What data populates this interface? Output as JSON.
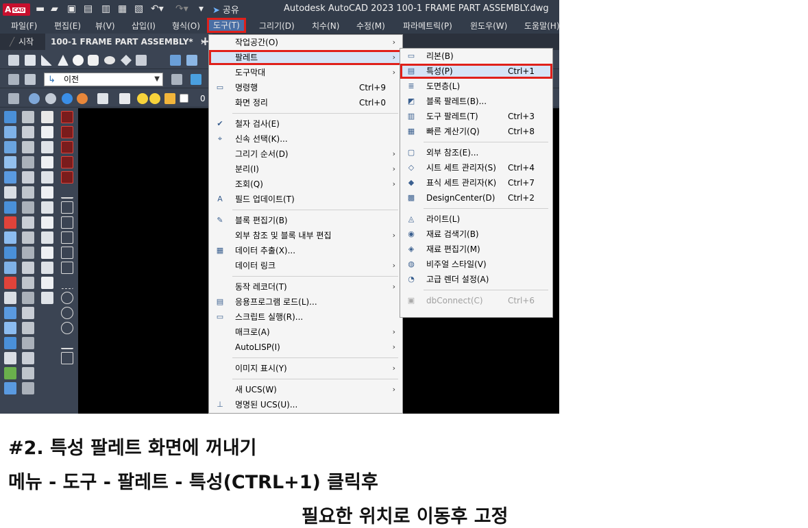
{
  "titlebar": {
    "logo_text": "A",
    "logo_badge": "CAD",
    "share_label": "공유",
    "window_title": "Autodesk AutoCAD 2023    100-1 FRAME PART ASSEMBLY.dwg"
  },
  "menubar": {
    "items": [
      "파일(F)",
      "편집(E)",
      "뷰(V)",
      "삽입(I)",
      "형식(O)",
      "도구(T)",
      "그리기(D)",
      "치수(N)",
      "수정(M)",
      "파라메트릭(P)",
      "윈도우(W)",
      "도움말(H)"
    ]
  },
  "tabs": {
    "start": "시작",
    "document": "100-1 FRAME PART ASSEMBLY*",
    "close": "×",
    "new": "+"
  },
  "toolbar": {
    "ucs_combo_value": "이전",
    "layer_value": "0"
  },
  "tools_menu": {
    "items": [
      {
        "label": "작업공간(O)",
        "shortcut": "",
        "submenu": true,
        "icon": ""
      },
      {
        "label": "팔레트",
        "shortcut": "",
        "submenu": true,
        "icon": "",
        "highlighted": true
      },
      {
        "label": "도구막대",
        "shortcut": "",
        "submenu": true,
        "icon": ""
      },
      {
        "label": "명령행",
        "shortcut": "Ctrl+9",
        "submenu": false,
        "icon": "command-line-icon"
      },
      {
        "label": "화면 정리",
        "shortcut": "Ctrl+0",
        "submenu": false,
        "icon": ""
      },
      {
        "separator": true
      },
      {
        "label": "철자 검사(E)",
        "shortcut": "",
        "submenu": false,
        "icon": "spell-check-icon"
      },
      {
        "label": "신속 선택(K)...",
        "shortcut": "",
        "submenu": false,
        "icon": "quick-select-icon"
      },
      {
        "label": "그리기 순서(D)",
        "shortcut": "",
        "submenu": true,
        "icon": ""
      },
      {
        "label": "분리(I)",
        "shortcut": "",
        "submenu": true,
        "icon": ""
      },
      {
        "label": "조회(Q)",
        "shortcut": "",
        "submenu": true,
        "icon": ""
      },
      {
        "label": "필드 업데이트(T)",
        "shortcut": "",
        "submenu": false,
        "icon": "update-field-icon"
      },
      {
        "separator": true
      },
      {
        "label": "블록 편집기(B)",
        "shortcut": "",
        "submenu": false,
        "icon": "block-editor-icon"
      },
      {
        "label": "외부 참조 및 블록 내부 편집",
        "shortcut": "",
        "submenu": true,
        "icon": ""
      },
      {
        "label": "데이터 추출(X)...",
        "shortcut": "",
        "submenu": false,
        "icon": "data-extraction-icon"
      },
      {
        "label": "데이터 링크",
        "shortcut": "",
        "submenu": true,
        "icon": ""
      },
      {
        "separator": true
      },
      {
        "label": "동작 레코더(T)",
        "shortcut": "",
        "submenu": true,
        "icon": ""
      },
      {
        "label": "응용프로그램 로드(L)...",
        "shortcut": "",
        "submenu": false,
        "icon": "load-application-icon"
      },
      {
        "label": "스크립트 실행(R)...",
        "shortcut": "",
        "submenu": false,
        "icon": "run-script-icon"
      },
      {
        "label": "매크로(A)",
        "shortcut": "",
        "submenu": true,
        "icon": ""
      },
      {
        "label": "AutoLISP(I)",
        "shortcut": "",
        "submenu": true,
        "icon": ""
      },
      {
        "separator": true
      },
      {
        "label": "이미지 표시(Y)",
        "shortcut": "",
        "submenu": true,
        "icon": ""
      },
      {
        "separator": true
      },
      {
        "label": "새 UCS(W)",
        "shortcut": "",
        "submenu": true,
        "icon": ""
      },
      {
        "label": "명명된 UCS(U)...",
        "shortcut": "",
        "submenu": false,
        "icon": "named-ucs-icon"
      }
    ]
  },
  "palettes_menu": {
    "items": [
      {
        "label": "리본(B)",
        "shortcut": "",
        "icon": "ribbon-icon"
      },
      {
        "label": "특성(P)",
        "shortcut": "Ctrl+1",
        "icon": "properties-icon",
        "highlighted": true
      },
      {
        "label": "도면층(L)",
        "shortcut": "",
        "icon": "layers-icon"
      },
      {
        "label": "블록 팔레트(B)...",
        "shortcut": "",
        "icon": "blocks-palette-icon"
      },
      {
        "label": "도구 팔레트(T)",
        "shortcut": "Ctrl+3",
        "icon": "tool-palettes-icon"
      },
      {
        "label": "빠른 계산기(Q)",
        "shortcut": "Ctrl+8",
        "icon": "calculator-icon"
      },
      {
        "separator": true
      },
      {
        "label": "외부 참조(E)...",
        "shortcut": "",
        "icon": "external-references-icon"
      },
      {
        "label": "시트 세트 관리자(S)",
        "shortcut": "Ctrl+4",
        "icon": "sheet-set-icon"
      },
      {
        "label": "표식 세트 관리자(K)",
        "shortcut": "Ctrl+7",
        "icon": "markup-set-icon"
      },
      {
        "label": "DesignCenter(D)",
        "shortcut": "Ctrl+2",
        "icon": "design-center-icon"
      },
      {
        "separator": true
      },
      {
        "label": "라이트(L)",
        "shortcut": "",
        "icon": "lights-icon"
      },
      {
        "label": "재료 검색기(B)",
        "shortcut": "",
        "icon": "materials-browser-icon"
      },
      {
        "label": "재료 편집기(M)",
        "shortcut": "",
        "icon": "materials-editor-icon"
      },
      {
        "label": "비주얼 스타일(V)",
        "shortcut": "",
        "icon": "visual-styles-icon"
      },
      {
        "label": "고급 렌더 설정(A)",
        "shortcut": "",
        "icon": "render-settings-icon"
      },
      {
        "separator": true
      },
      {
        "label": "dbConnect(C)",
        "shortcut": "Ctrl+6",
        "icon": "dbconnect-icon",
        "disabled": true
      }
    ]
  },
  "caption": {
    "line1": "#2. 특성 팔레트 화면에 꺼내기",
    "line2": "메뉴 - 도구 - 팔레트 - 특성(CTRL+1) 클릭후",
    "line3": "필요한 위치로 이동후 고정"
  },
  "colors": {
    "highlight_border": "#e0201a",
    "app_dark": "#333c4a",
    "canvas": "#000000"
  }
}
